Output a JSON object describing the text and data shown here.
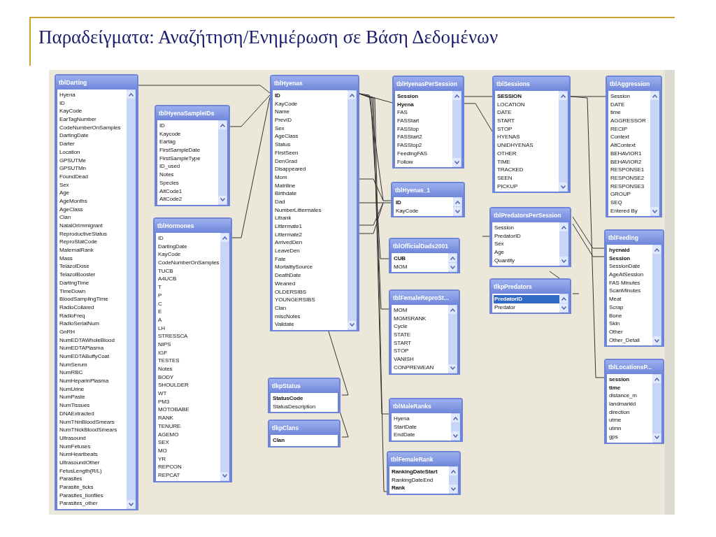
{
  "slide": {
    "title": "Παραδείγματα: Αναζήτηση/Ενημέρωση σε Βάση Δεδομένων"
  },
  "diagram": {
    "tables": [
      {
        "title": "tblDarting",
        "scrollable": true,
        "fields": [
          {
            "name": "Hyena",
            "key": false
          },
          {
            "name": "ID",
            "key": false
          },
          {
            "name": "KayCode",
            "key": false
          },
          {
            "name": "EarTagNumber",
            "key": false
          },
          {
            "name": "CodeNumberOnSamples",
            "key": false
          },
          {
            "name": "DartingDate",
            "key": false
          },
          {
            "name": "Darter",
            "key": false
          },
          {
            "name": "Location",
            "key": false
          },
          {
            "name": "GPSUTMe",
            "key": false
          },
          {
            "name": "GPSUTMn",
            "key": false
          },
          {
            "name": "FoundDead",
            "key": false
          },
          {
            "name": "Sex",
            "key": false
          },
          {
            "name": "Age",
            "key": false
          },
          {
            "name": "AgeMonths",
            "key": false
          },
          {
            "name": "AgeClass",
            "key": false
          },
          {
            "name": "Clan",
            "key": false
          },
          {
            "name": "NatalOrImmigrant",
            "key": false
          },
          {
            "name": "ReproductiveStatus",
            "key": false
          },
          {
            "name": "ReproStatCode",
            "key": false
          },
          {
            "name": "MaternalRank",
            "key": false
          },
          {
            "name": "Mass",
            "key": false
          },
          {
            "name": "TelazolDose",
            "key": false
          },
          {
            "name": "TelazolBooster",
            "key": false
          },
          {
            "name": "DartingTime",
            "key": false
          },
          {
            "name": "TimeDown",
            "key": false
          },
          {
            "name": "BloodSamplingTime",
            "key": false
          },
          {
            "name": "RadioCollared",
            "key": false
          },
          {
            "name": "RadioFreq",
            "key": false
          },
          {
            "name": "RadioSerialNum",
            "key": false
          },
          {
            "name": "GnRH",
            "key": false
          },
          {
            "name": "NumEDTAWholeBlood",
            "key": false
          },
          {
            "name": "NumEDTAPlasma",
            "key": false
          },
          {
            "name": "NumEDTABuffyCoat",
            "key": false
          },
          {
            "name": "NumSerum",
            "key": false
          },
          {
            "name": "NumRBC",
            "key": false
          },
          {
            "name": "NumHeparinPlasma",
            "key": false
          },
          {
            "name": "NumUrine",
            "key": false
          },
          {
            "name": "NumPaste",
            "key": false
          },
          {
            "name": "NumTissues",
            "key": false
          },
          {
            "name": "DNAExtracted",
            "key": false
          },
          {
            "name": "NumThinBloodSmears",
            "key": false
          },
          {
            "name": "NumThickBloodSmears",
            "key": false
          },
          {
            "name": "Ultrasound",
            "key": false
          },
          {
            "name": "NumFetuses",
            "key": false
          },
          {
            "name": "NumHeartbeats",
            "key": false
          },
          {
            "name": "UltrasoundOther",
            "key": false
          },
          {
            "name": "FetusLength(R/L)",
            "key": false
          },
          {
            "name": "Parasites",
            "key": false
          },
          {
            "name": "Parasite_ticks",
            "key": false
          },
          {
            "name": "Parasites_lionflies",
            "key": false
          },
          {
            "name": "Parasites_other",
            "key": false
          }
        ]
      },
      {
        "title": "tblHyenaSampleIDs",
        "scrollable": true,
        "fields": [
          {
            "name": "ID",
            "key": false
          },
          {
            "name": "Kaycode",
            "key": false
          },
          {
            "name": "Eartag",
            "key": false
          },
          {
            "name": "FirstSampleDate",
            "key": false
          },
          {
            "name": "FirstSampleType",
            "key": false
          },
          {
            "name": "ID_used",
            "key": false
          },
          {
            "name": "Notes",
            "key": false
          },
          {
            "name": "Species",
            "key": false
          },
          {
            "name": "AltCode1",
            "key": false
          },
          {
            "name": "AltCode2",
            "key": false
          }
        ]
      },
      {
        "title": "tblHormones",
        "scrollable": true,
        "fields": [
          {
            "name": "ID",
            "key": false
          },
          {
            "name": "DartingDate",
            "key": false
          },
          {
            "name": "KayCode",
            "key": false
          },
          {
            "name": "CodeNumberOnSamples",
            "key": false
          },
          {
            "name": "TUCB",
            "key": false
          },
          {
            "name": "A4UCB",
            "key": false
          },
          {
            "name": "T",
            "key": false
          },
          {
            "name": "P",
            "key": false
          },
          {
            "name": "C",
            "key": false
          },
          {
            "name": "E",
            "key": false
          },
          {
            "name": "A",
            "key": false
          },
          {
            "name": "LH",
            "key": false
          },
          {
            "name": "STRESSCA",
            "key": false
          },
          {
            "name": "NIPS",
            "key": false
          },
          {
            "name": "IGF",
            "key": false
          },
          {
            "name": "TESTES",
            "key": false
          },
          {
            "name": "Notes",
            "key": false
          },
          {
            "name": "BODY",
            "key": false
          },
          {
            "name": "SHOULDER",
            "key": false
          },
          {
            "name": "WT",
            "key": false
          },
          {
            "name": "PM3",
            "key": false
          },
          {
            "name": "MOTOBABE",
            "key": false
          },
          {
            "name": "RANK",
            "key": false
          },
          {
            "name": "TENURE",
            "key": false
          },
          {
            "name": "AGEMO",
            "key": false
          },
          {
            "name": "SEX",
            "key": false
          },
          {
            "name": "MO",
            "key": false
          },
          {
            "name": "YR",
            "key": false
          },
          {
            "name": "REPCON",
            "key": false
          },
          {
            "name": "REPCAT",
            "key": false
          }
        ]
      },
      {
        "title": "tblHyenas",
        "scrollable": true,
        "fields": [
          {
            "name": "ID",
            "key": true
          },
          {
            "name": "KayCode",
            "key": false
          },
          {
            "name": "Name",
            "key": false
          },
          {
            "name": "PrevID",
            "key": false
          },
          {
            "name": "Sex",
            "key": false
          },
          {
            "name": "AgeClass",
            "key": false
          },
          {
            "name": "Status",
            "key": false
          },
          {
            "name": "FirstSeen",
            "key": false
          },
          {
            "name": "DenGrad",
            "key": false
          },
          {
            "name": "Disappeared",
            "key": false
          },
          {
            "name": "Mom",
            "key": false
          },
          {
            "name": "Matriline",
            "key": false
          },
          {
            "name": "Birthdate",
            "key": false
          },
          {
            "name": "Dad",
            "key": false
          },
          {
            "name": "NumberLittermates",
            "key": false
          },
          {
            "name": "Litrank",
            "key": false
          },
          {
            "name": "Littermate1",
            "key": false
          },
          {
            "name": "Littermate2",
            "key": false
          },
          {
            "name": "ArrivedDen",
            "key": false
          },
          {
            "name": "LeaveDen",
            "key": false
          },
          {
            "name": "Fate",
            "key": false
          },
          {
            "name": "MortalitySource",
            "key": false
          },
          {
            "name": "DeathDate",
            "key": false
          },
          {
            "name": "Weaned",
            "key": false
          },
          {
            "name": "OLDERSIBS",
            "key": false
          },
          {
            "name": "YOUNGERSIBS",
            "key": false
          },
          {
            "name": "Clan",
            "key": false
          },
          {
            "name": "miscNotes",
            "key": false
          },
          {
            "name": "Validate",
            "key": false
          }
        ]
      },
      {
        "title": "tlkpStatus",
        "scrollable": false,
        "fields": [
          {
            "name": "StatusCode",
            "key": true
          },
          {
            "name": "StatusDescription",
            "key": false
          }
        ]
      },
      {
        "title": "tlkpClans",
        "scrollable": false,
        "fields": [
          {
            "name": "Clan",
            "key": true
          }
        ]
      },
      {
        "title": "tblHyenasPerSession",
        "scrollable": true,
        "fields": [
          {
            "name": "Session",
            "key": true
          },
          {
            "name": "Hyena",
            "key": true
          },
          {
            "name": "FAS",
            "key": false
          },
          {
            "name": "FASStart",
            "key": false
          },
          {
            "name": "FASStop",
            "key": false
          },
          {
            "name": "FASStart2",
            "key": false
          },
          {
            "name": "FASStop2",
            "key": false
          },
          {
            "name": "FeedingFAS",
            "key": false
          },
          {
            "name": "Follow",
            "key": false
          }
        ]
      },
      {
        "title": "tblHyenas_1",
        "scrollable": true,
        "fields": [
          {
            "name": "ID",
            "key": true
          },
          {
            "name": "KayCode",
            "key": false
          }
        ]
      },
      {
        "title": "tblOfficialDads2001",
        "scrollable": true,
        "fields": [
          {
            "name": "CUB",
            "key": true
          },
          {
            "name": "MOM",
            "key": false
          }
        ]
      },
      {
        "title": "tblFemaleReproSt...",
        "scrollable": true,
        "fields": [
          {
            "name": "MOM",
            "key": false
          },
          {
            "name": "MOMSRANK",
            "key": false
          },
          {
            "name": "Cycle",
            "key": false
          },
          {
            "name": "STATE",
            "key": false
          },
          {
            "name": "START",
            "key": false
          },
          {
            "name": "STOP",
            "key": false
          },
          {
            "name": "VANISH",
            "key": false
          },
          {
            "name": "CONPREWEAN",
            "key": false
          }
        ]
      },
      {
        "title": "tblMaleRanks",
        "scrollable": true,
        "fields": [
          {
            "name": "Hyena",
            "key": false
          },
          {
            "name": "StartDate",
            "key": false
          },
          {
            "name": "EndDate",
            "key": false
          }
        ]
      },
      {
        "title": "tblFemaleRank",
        "scrollable": true,
        "fields": [
          {
            "name": "RankingDateStart",
            "key": true
          },
          {
            "name": "RankingDateEnd",
            "key": false
          },
          {
            "name": "Rank",
            "key": true
          }
        ]
      },
      {
        "title": "tblSessions",
        "scrollable": true,
        "fields": [
          {
            "name": "SESSION",
            "key": true
          },
          {
            "name": "LOCATION",
            "key": false
          },
          {
            "name": "DATE",
            "key": false
          },
          {
            "name": "START",
            "key": false
          },
          {
            "name": "STOP",
            "key": false
          },
          {
            "name": "HYENAS",
            "key": false
          },
          {
            "name": "UNIDHYENAS",
            "key": false
          },
          {
            "name": "OTHER",
            "key": false
          },
          {
            "name": "TIME",
            "key": false
          },
          {
            "name": "TRACKED",
            "key": false
          },
          {
            "name": "SEEN",
            "key": false
          },
          {
            "name": "PICKUP",
            "key": false
          }
        ]
      },
      {
        "title": "tblPredatorsPerSession",
        "scrollable": true,
        "fields": [
          {
            "name": "Session",
            "key": false
          },
          {
            "name": "PredatorID",
            "key": false
          },
          {
            "name": "Sex",
            "key": false
          },
          {
            "name": "Age",
            "key": false
          },
          {
            "name": "Quantity",
            "key": false
          }
        ]
      },
      {
        "title": "tlkpPredators",
        "scrollable": true,
        "fields": [
          {
            "name": "PredatorID",
            "key": true,
            "selected": true
          },
          {
            "name": "Predator",
            "key": false,
            "selected": false
          }
        ]
      },
      {
        "title": "tblAggression",
        "scrollable": true,
        "fields": [
          {
            "name": "Session",
            "key": false
          },
          {
            "name": "DATE",
            "key": false
          },
          {
            "name": "time",
            "key": false
          },
          {
            "name": "AGGRESSOR",
            "key": false
          },
          {
            "name": "RECIP",
            "key": false
          },
          {
            "name": "Context",
            "key": false
          },
          {
            "name": "AltContext",
            "key": false
          },
          {
            "name": "BEHAVIOR1",
            "key": false
          },
          {
            "name": "BEHAVIOR2",
            "key": false
          },
          {
            "name": "RESPONSE1",
            "key": false
          },
          {
            "name": "RESPONSE2",
            "key": false
          },
          {
            "name": "RESPONSE3",
            "key": false
          },
          {
            "name": "GROUP",
            "key": false
          },
          {
            "name": "SEQ",
            "key": false
          },
          {
            "name": "Entered By",
            "key": false
          }
        ]
      },
      {
        "title": "tblFeeding",
        "scrollable": true,
        "fields": [
          {
            "name": "hyenaid",
            "key": true
          },
          {
            "name": "Session",
            "key": true
          },
          {
            "name": "SessionDate",
            "key": false
          },
          {
            "name": "AgeAtSession",
            "key": false
          },
          {
            "name": "FAS Minutes",
            "key": false
          },
          {
            "name": "ScanMinutes",
            "key": false
          },
          {
            "name": "Meat",
            "key": false
          },
          {
            "name": "Scrap",
            "key": false
          },
          {
            "name": "Bone",
            "key": false
          },
          {
            "name": "Skin",
            "key": false
          },
          {
            "name": "Other",
            "key": false
          },
          {
            "name": "Other_Detail",
            "key": false
          }
        ]
      },
      {
        "title": "tblLocationsP...",
        "scrollable": true,
        "fields": [
          {
            "name": "session",
            "key": true
          },
          {
            "name": "time",
            "key": true
          },
          {
            "name": "distance_m",
            "key": false
          },
          {
            "name": "landmarkid",
            "key": false
          },
          {
            "name": "direction",
            "key": false
          },
          {
            "name": "utme",
            "key": false
          },
          {
            "name": "utmn",
            "key": false
          },
          {
            "name": "gps",
            "key": false
          }
        ]
      }
    ]
  }
}
